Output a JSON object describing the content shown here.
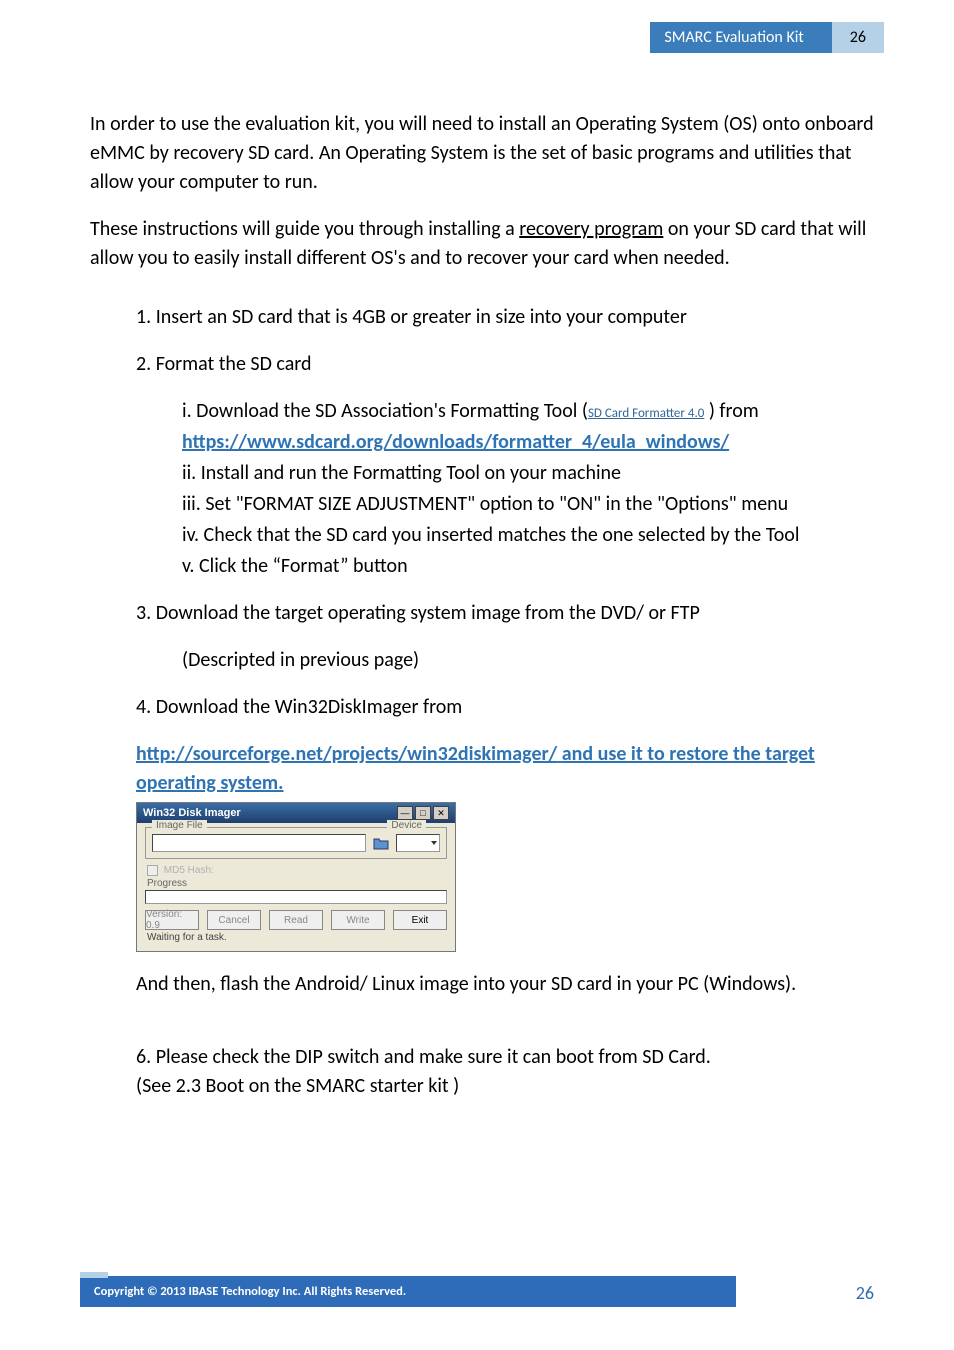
{
  "header": {
    "title": "SMARC  Evaluation  Kit",
    "page": "26"
  },
  "body": {
    "intro1": "In order to use the evaluation kit, you will need to install an Operating System (OS) onto onboard eMMC by recovery SD card. An Operating System is the set of basic programs and utilities that allow your computer to run.",
    "intro2_before": "These instructions will guide you through installing a ",
    "intro2_underlined": "recovery program",
    "intro2_after": " on your SD card that will allow you to easily install different OS's and to recover your card when needed."
  },
  "steps": {
    "s1": "1. Insert an SD card that is 4GB or greater in size into your computer",
    "s2": "2. Format the SD card",
    "s2i_pre": "i. Download the SD Association's Formatting Tool (",
    "s2i_linktext": "SD Card Formatter 4.0",
    "s2i_post": " ) from",
    "s2i_url": "https://www.sdcard.org/downloads/formatter_4/eula_windows/",
    "s2ii": "ii. Install and run the Formatting Tool on your machine",
    "s2iii": "iii. Set \"FORMAT SIZE ADJUSTMENT\" option to \"ON\" in the \"Options\" menu",
    "s2iv": "iv. Check that the SD card you inserted matches the one selected by the Tool",
    "s2v": "v. Click the “Format” button",
    "s3": "3. Download the target operating system image from the DVD/ or FTP",
    "s3desc": " (Descripted in previous page)",
    "s4": "4. Download the Win32DiskImager from",
    "s4url": "http://sourceforge.net/projects/win32diskimager/",
    "s4url_post": "and use it to restore the target operating system."
  },
  "win": {
    "title": "Win32 Disk Imager",
    "group1": "Image File",
    "device": "Device",
    "md5": "MD5 Hash:",
    "progress": "Progress",
    "btn_version": "Version: 0.9",
    "btn_cancel": "Cancel",
    "btn_read": "Read",
    "btn_write": "Write",
    "btn_exit": "Exit",
    "status": "Waiting for a task."
  },
  "after": {
    "flash": "And then, flash the Android/ Linux image into your SD card in your PC (Windows).",
    "s6a": "6. Please check the DIP switch and make sure it can boot from SD Card.",
    "s6b": "(See 2.3 Boot on the SMARC starter kit )"
  },
  "footer": {
    "copyright": "Copyright  ©  2013  IBASE  Technology  Inc.  All  Rights  Reserved.",
    "page": "26"
  }
}
